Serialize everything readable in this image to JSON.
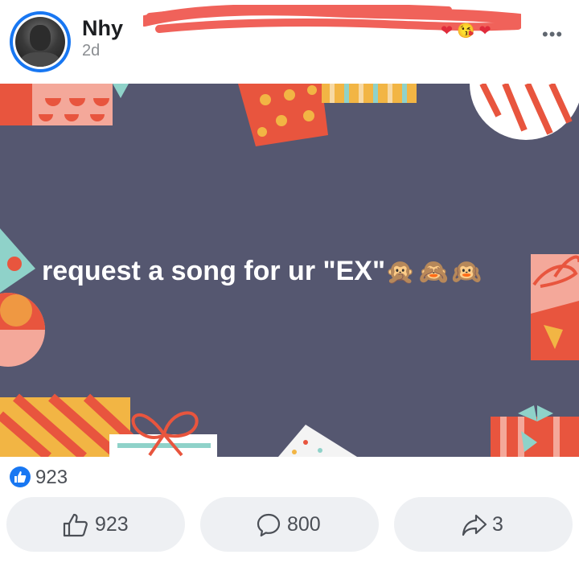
{
  "post": {
    "author": "Nhy",
    "time": "2d",
    "header_emojis": "❤ 😘 ❤",
    "more": "•••",
    "text": "request a song for ur \"EX\"",
    "text_emojis": "🙊🙈🙉"
  },
  "reactions": {
    "icon": "like-icon",
    "count": "923"
  },
  "actions": {
    "like_count": "923",
    "comment_count": "800",
    "share_count": "3"
  },
  "colors": {
    "brand": "#1877f2",
    "image_background": "#555770",
    "redaction": "#f0625a"
  }
}
